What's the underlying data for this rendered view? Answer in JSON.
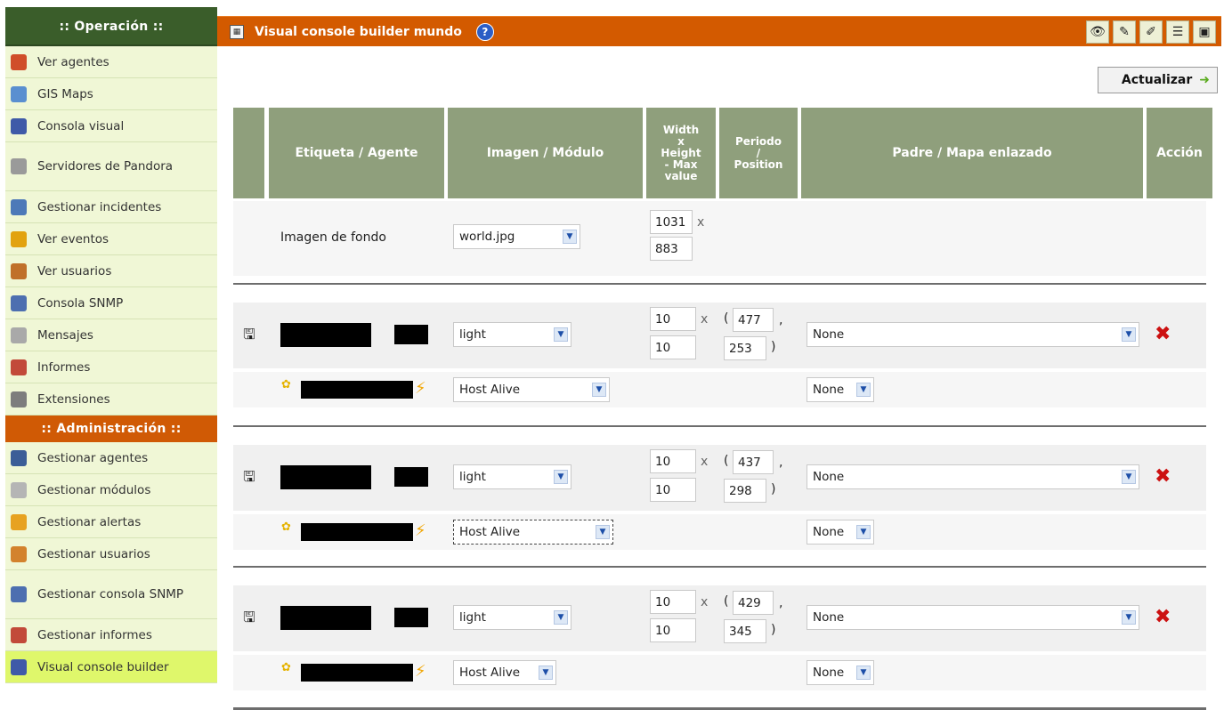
{
  "sidebar": {
    "operation_header": ":: Operación ::",
    "operation_items": [
      {
        "label": "Ver agentes",
        "icon": "agents-icon",
        "color": "#d04e2a"
      },
      {
        "label": "GIS Maps",
        "icon": "globe-icon",
        "color": "#5a8fd0"
      },
      {
        "label": "Consola visual",
        "icon": "monitor-icon",
        "color": "#3f5aa8"
      },
      {
        "label": "Servidores de Pandora",
        "icon": "server-icon",
        "color": "#9a9a9a"
      },
      {
        "label": "Gestionar incidentes",
        "icon": "incidents-icon",
        "color": "#4d79b8"
      },
      {
        "label": "Ver eventos",
        "icon": "events-icon",
        "color": "#e2a20f"
      },
      {
        "label": "Ver usuarios",
        "icon": "users-icon",
        "color": "#c0702a"
      },
      {
        "label": "Consola SNMP",
        "icon": "snmp-icon",
        "color": "#4d6fb0"
      },
      {
        "label": "Mensajes",
        "icon": "mail-icon",
        "color": "#a9a9a9"
      },
      {
        "label": "Informes",
        "icon": "reports-icon",
        "color": "#c24a3a"
      },
      {
        "label": "Extensiones",
        "icon": "extensions-icon",
        "color": "#7d7d7d"
      }
    ],
    "admin_header": ":: Administración ::",
    "admin_items": [
      {
        "label": "Gestionar agentes",
        "icon": "manage-agents-icon",
        "color": "#3b5e97"
      },
      {
        "label": "Gestionar módulos",
        "icon": "modules-icon",
        "color": "#b5b5b5"
      },
      {
        "label": "Gestionar alertas",
        "icon": "alerts-icon",
        "color": "#e7a221"
      },
      {
        "label": "Gestionar usuarios",
        "icon": "manage-users-icon",
        "color": "#d3822d"
      },
      {
        "label": "Gestionar consola SNMP",
        "icon": "manage-snmp-icon",
        "color": "#4d6fb0"
      },
      {
        "label": "Gestionar informes",
        "icon": "manage-reports-icon",
        "color": "#c24a3a"
      },
      {
        "label": "Visual console builder",
        "icon": "console-builder-icon",
        "color": "#3f5aa8"
      }
    ]
  },
  "header": {
    "title": "Visual console builder mundo",
    "help_symbol": "?",
    "tools": [
      {
        "name": "view-icon",
        "glyph": "👁"
      },
      {
        "name": "brush-icon",
        "glyph": "✎"
      },
      {
        "name": "wizard-icon",
        "glyph": "✐"
      },
      {
        "name": "list-icon",
        "glyph": "☰"
      },
      {
        "name": "builder-icon",
        "glyph": "▣"
      }
    ]
  },
  "update_button": {
    "label": "Actualizar",
    "arrow": "➜"
  },
  "table": {
    "headers": {
      "label_agent": "Etiqueta / Agente",
      "image_module": "Imagen / Módulo",
      "size_lines": [
        "Width",
        "x",
        "Height",
        "- Max",
        "value"
      ],
      "period_lines": [
        "Periodo",
        "/",
        "Position"
      ],
      "parent_map": "Padre / Mapa enlazado",
      "action": "Acción"
    },
    "background": {
      "label": "Imagen de fondo",
      "image": "world.jpg",
      "width": "1031",
      "height": "883",
      "x_sep": "x"
    },
    "items": [
      {
        "image": "light",
        "width": "10",
        "height": "10",
        "x_sep": "x",
        "pos_x": "477",
        "pos_y": "253",
        "parent": "None",
        "module": "Host Alive",
        "map": "None"
      },
      {
        "image": "light",
        "width": "10",
        "height": "10",
        "x_sep": "x",
        "pos_x": "437",
        "pos_y": "298",
        "parent": "None",
        "module": "Host Alive",
        "map": "None"
      },
      {
        "image": "light",
        "width": "10",
        "height": "10",
        "x_sep": "x",
        "pos_x": "429",
        "pos_y": "345",
        "parent": "None",
        "module": "Host Alive",
        "map": "None"
      }
    ],
    "paren_open": "(",
    "paren_close": ")",
    "comma": ","
  }
}
